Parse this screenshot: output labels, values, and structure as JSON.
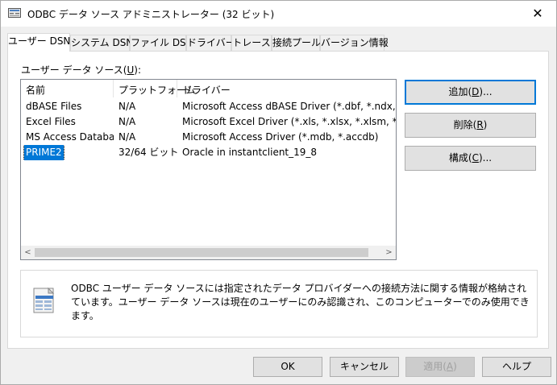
{
  "window": {
    "title": "ODBC データ ソース アドミニストレーター (32 ビット)",
    "close_glyph": "✕"
  },
  "tabs": [
    {
      "label": "ユーザー DSN",
      "active": true
    },
    {
      "label": "システム DSN",
      "active": false
    },
    {
      "label": "ファイル DSN",
      "active": false
    },
    {
      "label": "ドライバー",
      "active": false
    },
    {
      "label": "トレース",
      "active": false
    },
    {
      "label": "接続プール",
      "active": false
    },
    {
      "label": "バージョン情報",
      "active": false
    }
  ],
  "list": {
    "label_prefix": "ユーザー データ ソース(",
    "label_hotkey": "U",
    "label_suffix": "):",
    "columns": [
      "名前",
      "プラットフォーム",
      "ドライバー"
    ],
    "rows": [
      {
        "name": "dBASE Files",
        "platform": "N/A",
        "driver": "Microsoft Access dBASE Driver (*.dbf, *.ndx, *.mdx)"
      },
      {
        "name": "Excel Files",
        "platform": "N/A",
        "driver": "Microsoft Excel Driver (*.xls, *.xlsx, *.xlsm, *.xlsb)"
      },
      {
        "name": "MS Access Database",
        "platform": "N/A",
        "driver": "Microsoft Access Driver (*.mdb, *.accdb)"
      },
      {
        "name": "PRIME2",
        "platform": "32/64 ビット",
        "driver": "Oracle in instantclient_19_8",
        "selected": true
      }
    ],
    "scroll_left": "<",
    "scroll_right": ">"
  },
  "side_buttons": {
    "add": {
      "prefix": "追加(",
      "hotkey": "D",
      "suffix": ")..."
    },
    "remove": {
      "prefix": "削除(",
      "hotkey": "R",
      "suffix": ")"
    },
    "configure": {
      "prefix": "構成(",
      "hotkey": "C",
      "suffix": ")..."
    }
  },
  "info": {
    "text": "ODBC ユーザー データ ソースには指定されたデータ プロバイダーへの接続方法に関する情報が格納されています。ユーザー データ ソースは現在のユーザーにのみ認識され、このコンピューターでのみ使用できます。"
  },
  "bottom_buttons": {
    "ok": "OK",
    "cancel": "キャンセル",
    "apply": {
      "prefix": "適用(",
      "hotkey": "A",
      "suffix": ")"
    },
    "help": "ヘルプ"
  },
  "colors": {
    "selection": "#0078d7",
    "accent_border": "#0078d7"
  }
}
